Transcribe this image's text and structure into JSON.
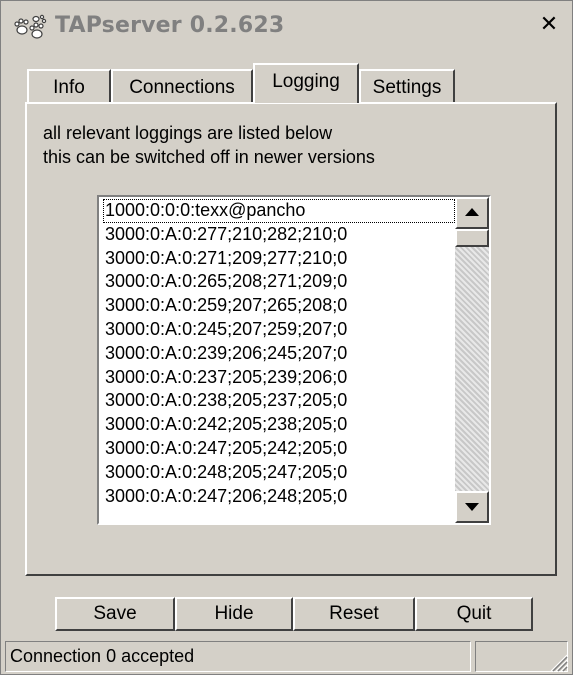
{
  "window": {
    "title": "TAPserver 0.2.623",
    "close_glyph": "✕"
  },
  "tabs": [
    {
      "label": "Info",
      "active": false
    },
    {
      "label": "Connections",
      "active": false
    },
    {
      "label": "Logging",
      "active": true
    },
    {
      "label": "Settings",
      "active": false
    }
  ],
  "logging": {
    "description_line1": "all relevant loggings are listed below",
    "description_line2": "this can be switched off in newer versions",
    "entries": [
      "1000:0:0:0:texx@pancho",
      "3000:0:A:0:277;210;282;210;0",
      "3000:0:A:0:271;209;277;210;0",
      "3000:0:A:0:265;208;271;209;0",
      "3000:0:A:0:259;207;265;208;0",
      "3000:0:A:0:245;207;259;207;0",
      "3000:0:A:0:239;206;245;207;0",
      "3000:0:A:0:237;205;239;206;0",
      "3000:0:A:0:238;205;237;205;0",
      "3000:0:A:0:242;205;238;205;0",
      "3000:0:A:0:247;205;242;205;0",
      "3000:0:A:0:248;205;247;205;0",
      "3000:0:A:0:247;206;248;205;0"
    ]
  },
  "buttons": {
    "save": "Save",
    "hide": "Hide",
    "reset": "Reset",
    "quit": "Quit"
  },
  "statusbar": {
    "text": "Connection 0 accepted"
  }
}
